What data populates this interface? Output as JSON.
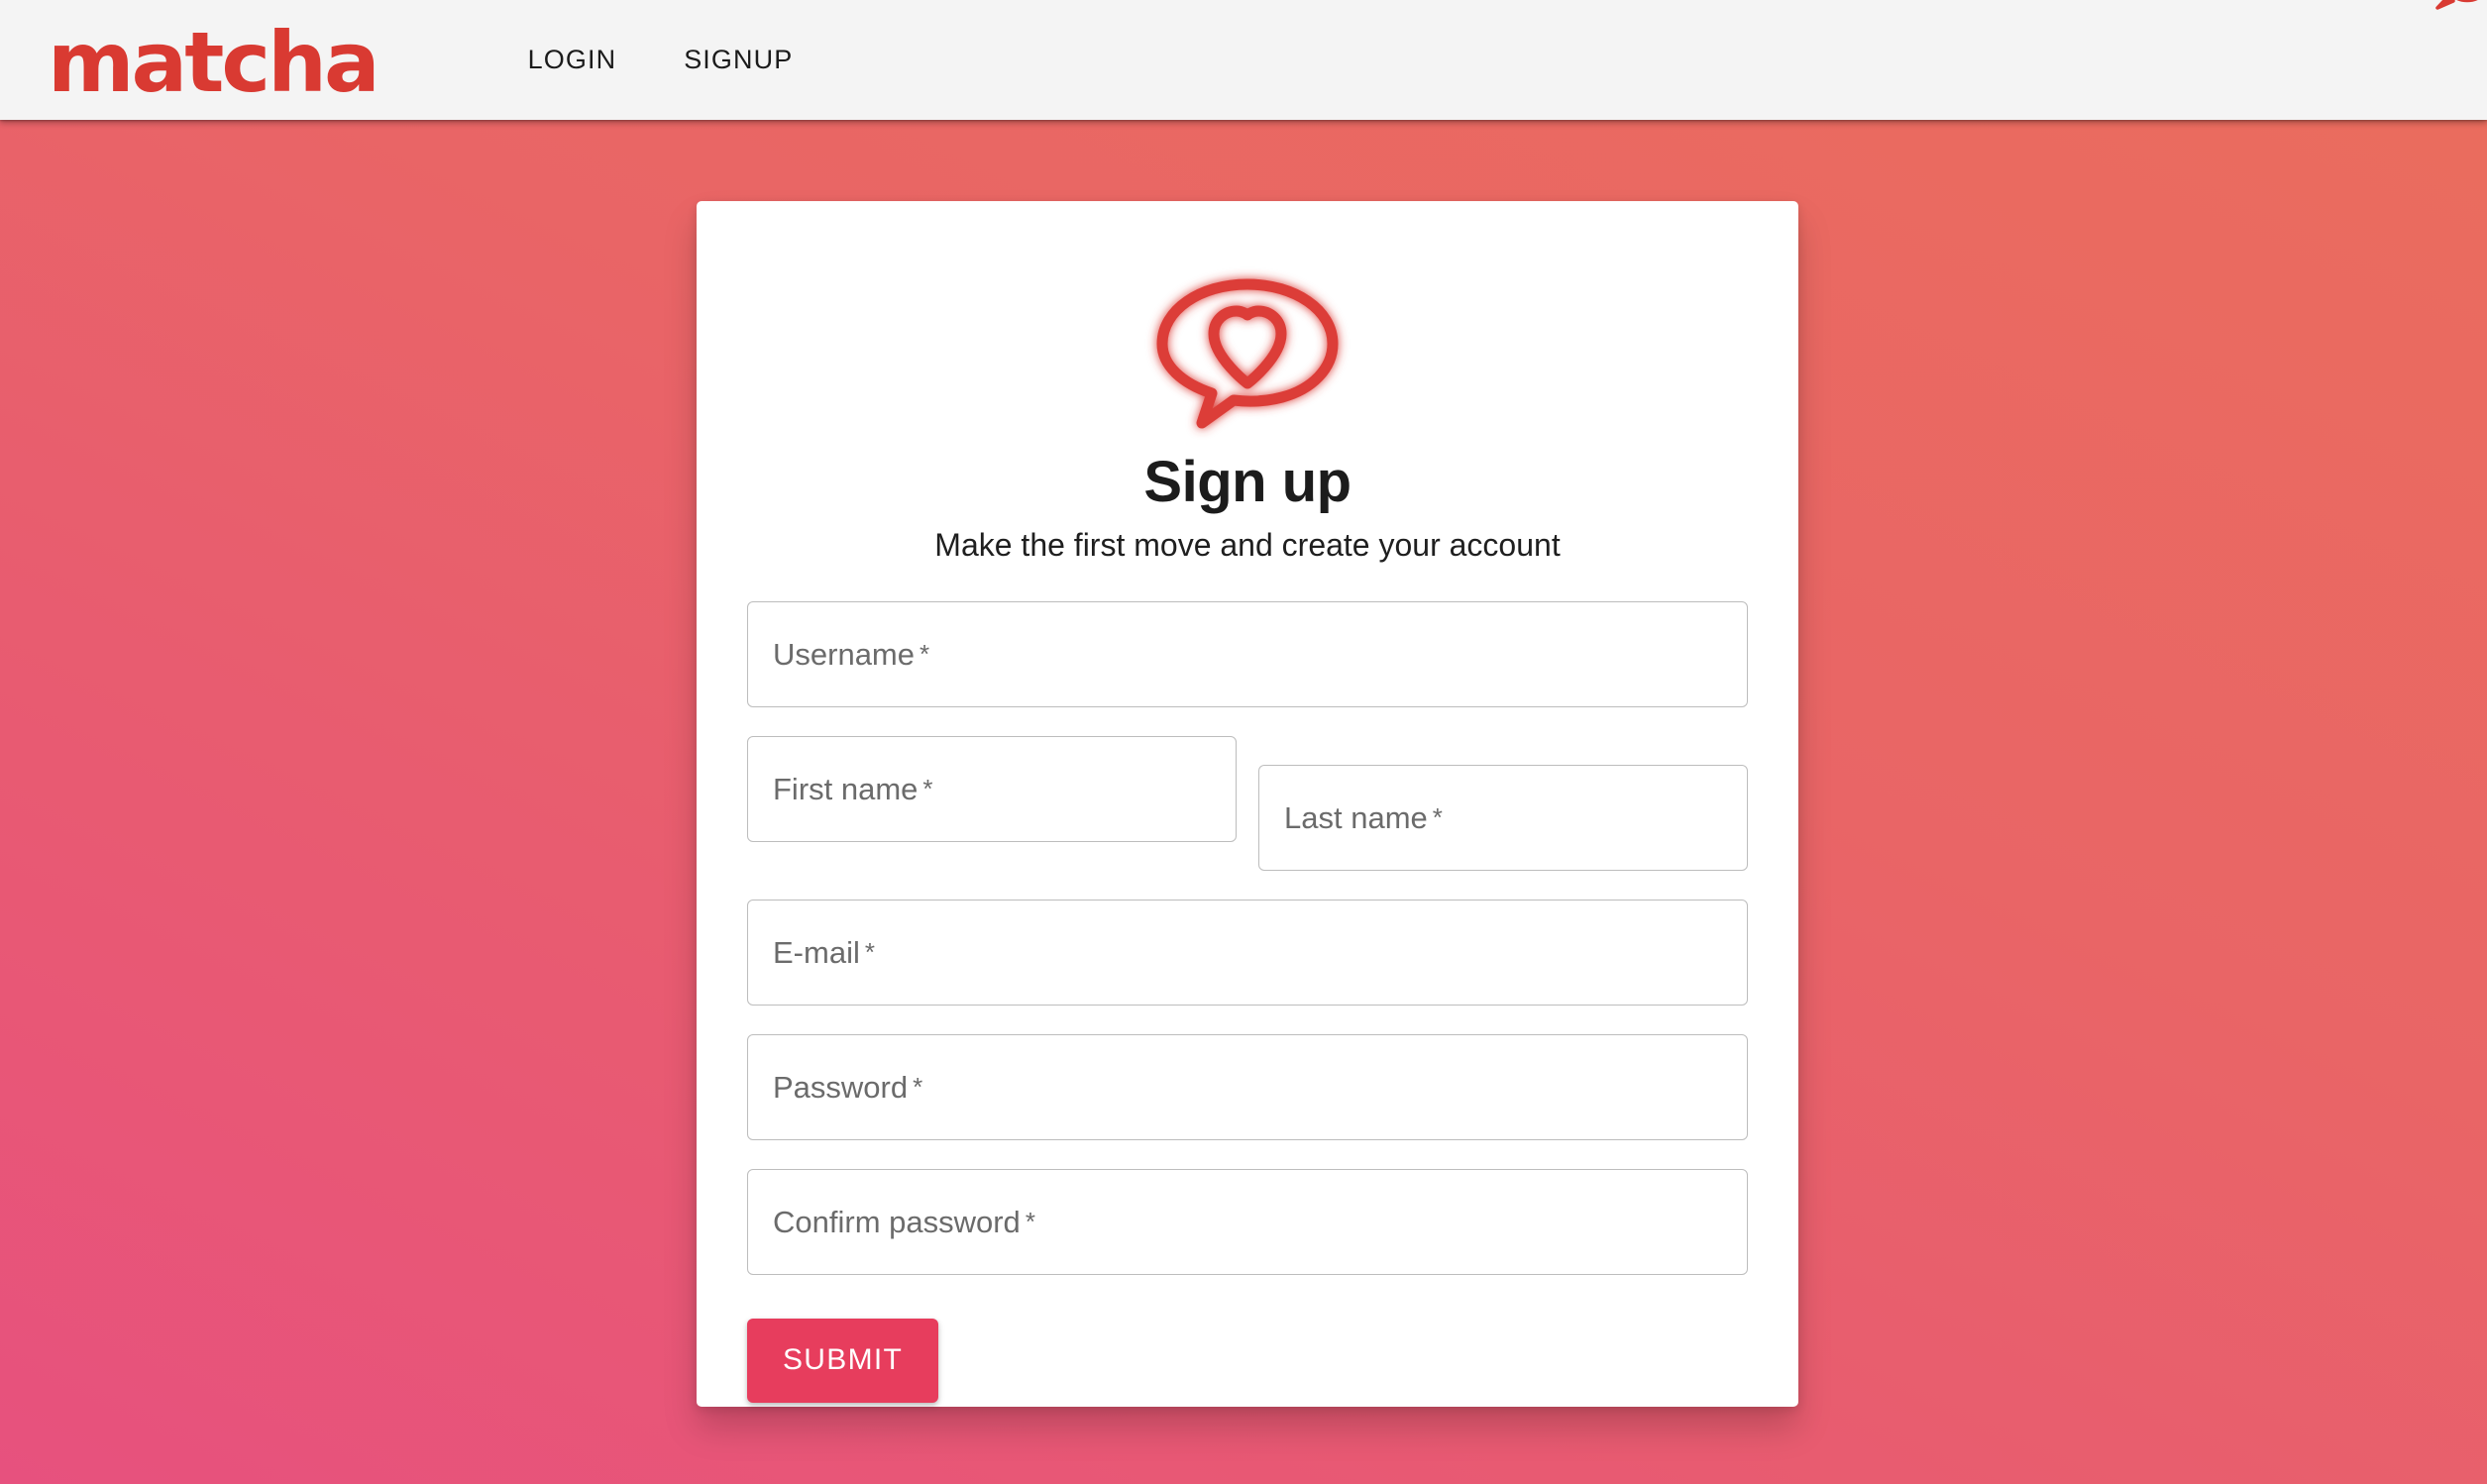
{
  "brand": {
    "wordmark": "matcha",
    "logo_icon": "heart-speech-bubble-icon",
    "color": "#d93a32"
  },
  "navbar": {
    "background": "#f4f4f4",
    "links": [
      {
        "label": "LOGIN"
      },
      {
        "label": "SIGNUP"
      }
    ]
  },
  "page": {
    "background_gradient_from": "#ea6d5d",
    "background_gradient_to": "#e7517e"
  },
  "card": {
    "logo_icon": "heart-speech-bubble-icon",
    "title": "Sign up",
    "subtitle": "Make the first move and create your account",
    "accent_color": "#e73d5d",
    "form": {
      "fields": [
        {
          "name": "username",
          "label": "Username",
          "required_marker": "*",
          "value": "",
          "type": "text"
        },
        {
          "name": "first-name",
          "label": "First name",
          "required_marker": "*",
          "value": "",
          "type": "text"
        },
        {
          "name": "last-name",
          "label": "Last name",
          "required_marker": "*",
          "value": "",
          "type": "text"
        },
        {
          "name": "email",
          "label": "E-mail",
          "required_marker": "*",
          "value": "",
          "type": "email"
        },
        {
          "name": "password",
          "label": "Password",
          "required_marker": "*",
          "value": "",
          "type": "password"
        },
        {
          "name": "confirm-password",
          "label": "Confirm password",
          "required_marker": "*",
          "value": "",
          "type": "password"
        }
      ],
      "submit_label": "SUBMIT"
    }
  }
}
